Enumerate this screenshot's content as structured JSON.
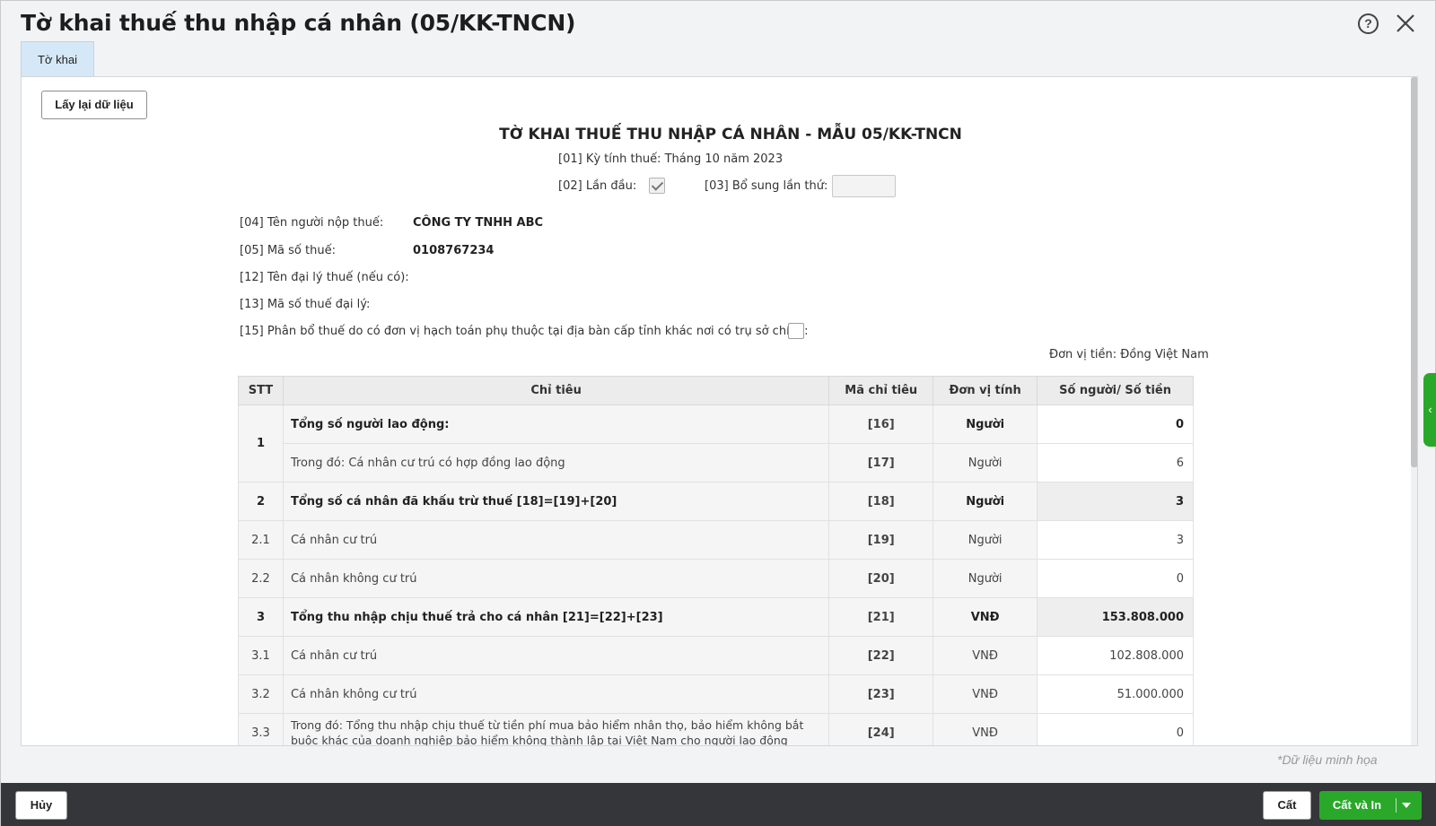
{
  "window": {
    "title": "Tờ khai thuế thu nhập cá nhân (05/KK-TNCN)",
    "help_icon": "question-circle-icon",
    "close_icon": "close-icon",
    "tab_label": "Tờ khai"
  },
  "toolbar": {
    "reload_label": "Lấy lại dữ liệu"
  },
  "form": {
    "heading": "TỜ KHAI THUẾ THU NHẬP CÁ NHÂN - MẪU 05/KK-TNCN",
    "period_label": "[01] Kỳ tính thuế: Tháng 10 năm 2023",
    "first_time_label": "[02] Lần đầu:",
    "first_time_checked": true,
    "supplement_label": "[03] Bổ sung lần thứ:",
    "supplement_value": "",
    "taxpayer_name_label": "[04] Tên người nộp thuế:",
    "taxpayer_name": "CÔNG TY TNHH ABC",
    "tax_code_label": "[05] Mã số thuế:",
    "tax_code": "0108767234",
    "agent_name_label": "[12] Tên đại lý thuế (nếu có):",
    "agent_code_label": "[13] Mã số thuế đại lý:",
    "allocation_label": "[15] Phân bổ thuế do có đơn vị hạch toán phụ thuộc tại địa bàn cấp tỉnh khác nơi có trụ sở chính:",
    "allocation_checked": false,
    "currency_note": "Đơn vị tiền: Đồng Việt Nam"
  },
  "table": {
    "headers": [
      "STT",
      "Chỉ tiêu",
      "Mã chỉ tiêu",
      "Đơn vị tính",
      "Số người/ Số tiền"
    ],
    "rows": [
      {
        "stt": "1",
        "chi_tieu": "Tổng số người lao động:",
        "ma": "[16]",
        "dvt": "Người",
        "so": "0"
      },
      {
        "stt": "",
        "chi_tieu": "Trong đó: Cá nhân cư trú có hợp đồng lao động",
        "ma": "[17]",
        "dvt": "Người",
        "so": "6"
      },
      {
        "stt": "2",
        "chi_tieu": "Tổng số cá nhân đã khấu trừ thuế [18]=[19]+[20]",
        "ma": "[18]",
        "dvt": "Người",
        "so": "3"
      },
      {
        "stt": "2.1",
        "chi_tieu": "Cá nhân cư trú",
        "ma": "[19]",
        "dvt": "Người",
        "so": "3"
      },
      {
        "stt": "2.2",
        "chi_tieu": "Cá nhân không cư trú",
        "ma": "[20]",
        "dvt": "Người",
        "so": "0"
      },
      {
        "stt": "3",
        "chi_tieu": "Tổng thu nhập chịu thuế trả cho cá nhân [21]=[22]+[23]",
        "ma": "[21]",
        "dvt": "VNĐ",
        "so": "153.808.000"
      },
      {
        "stt": "3.1",
        "chi_tieu": "Cá nhân cư trú",
        "ma": "[22]",
        "dvt": "VNĐ",
        "so": "102.808.000"
      },
      {
        "stt": "3.2",
        "chi_tieu": "Cá nhân không cư trú",
        "ma": "[23]",
        "dvt": "VNĐ",
        "so": "51.000.000"
      },
      {
        "stt": "3.3",
        "chi_tieu": "Trong đó: Tổng thu nhập chịu thuế từ tiền phí mua bảo hiểm nhân thọ, bảo hiểm không bắt buộc khác của doanh nghiệp bảo hiểm không thành lập tại Việt Nam cho người lao động",
        "ma": "[24]",
        "dvt": "VNĐ",
        "so": "0"
      }
    ]
  },
  "demo_note": "*Dữ liệu minh họa",
  "footer": {
    "cancel_label": "Hủy",
    "save_label": "Cất",
    "save_print_label": "Cất và In"
  },
  "colors": {
    "accent_green": "#2aa82a",
    "footer_bg": "#343639",
    "tab_bg": "#d5e8f7"
  }
}
